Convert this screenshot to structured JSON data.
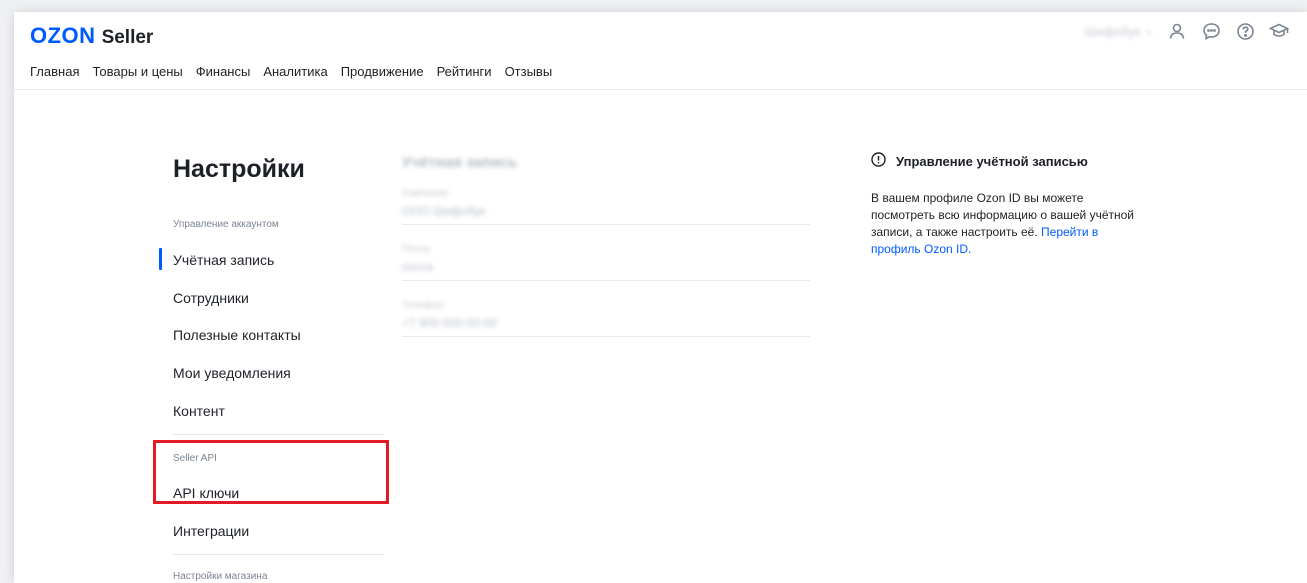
{
  "header": {
    "logo_brand": "OZON",
    "logo_product": "Seller",
    "company_name": "Шифобук",
    "icons": [
      "user-icon",
      "chat-icon",
      "help-icon",
      "education-icon"
    ]
  },
  "topnav": {
    "items": [
      {
        "label": "Главная"
      },
      {
        "label": "Товары и цены"
      },
      {
        "label": "Финансы"
      },
      {
        "label": "Аналитика"
      },
      {
        "label": "Продвижение"
      },
      {
        "label": "Рейтинги"
      },
      {
        "label": "Отзывы"
      }
    ]
  },
  "settings": {
    "title": "Настройки",
    "sections": [
      {
        "label": "Управление аккаунтом",
        "items": [
          {
            "label": "Учётная запись",
            "active": true
          },
          {
            "label": "Сотрудники"
          },
          {
            "label": "Полезные контакты"
          },
          {
            "label": "Мои уведомления"
          },
          {
            "label": "Контент"
          }
        ]
      },
      {
        "label": "Seller API",
        "items": [
          {
            "label": "API ключи",
            "highlighted": true
          },
          {
            "label": "Интеграции"
          }
        ]
      },
      {
        "label": "Настройки магазина",
        "items": []
      }
    ]
  },
  "account": {
    "title": "Учётная запись",
    "fields": [
      {
        "label": "Компания",
        "value": "ООО Шифобук"
      },
      {
        "label": "Почта",
        "value": "почта"
      },
      {
        "label": "Телефон",
        "value": "+7 900 000-00-00"
      }
    ]
  },
  "info": {
    "title": "Управление учётной записью",
    "text": "В вашем профиле Ozon ID вы можете посмотреть всю информацию о вашей учётной записи, а также настроить её.",
    "link": "Перейти в профиль Ozon ID."
  },
  "colors": {
    "brand": "#005bff",
    "highlight": "#e11b26"
  }
}
